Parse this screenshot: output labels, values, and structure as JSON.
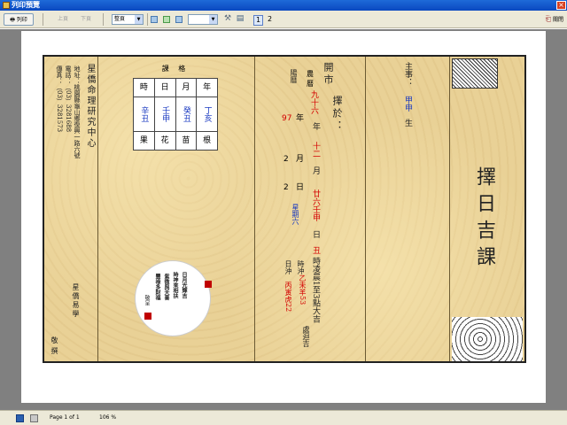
{
  "window": {
    "title": "列印預覽"
  },
  "toolbar": {
    "print_label": "列印",
    "prev_label": "上頁",
    "next_label": "下頁",
    "zoom_select": "整頁",
    "page_buttons": [
      "1",
      "2"
    ],
    "close_label": "關閉"
  },
  "status": {
    "page": "Page 1 of 1",
    "zoom": "106 %"
  },
  "doc": {
    "institute": "星僑命理研究中心",
    "address": "地址：桃園縣龜山鄉復興一路六號",
    "phone": "電話：（03）3281688",
    "fax": "傳真：（03）3281573",
    "footer_name": "星僑易學",
    "footer_note": "敬撰",
    "table_title": "課 格",
    "headers": [
      "時",
      "日",
      "月",
      "年"
    ],
    "pillars": [
      "辛丑",
      "壬申",
      "癸丑",
      "丁亥"
    ],
    "labels": [
      "果",
      "花",
      "苗",
      "根"
    ],
    "poem": [
      "日月光輝吉",
      "時神來相扶",
      "紫微與天喜",
      "豐祿多財福"
    ],
    "poem_sign": "敬呈",
    "open_title": "開市",
    "choose_on": "擇於：",
    "lunar_label": "農曆",
    "lunar_year": "九十六",
    "lunar_month": "十二",
    "solar_label": "陽曆",
    "solar_year": "97",
    "solar_month": "2",
    "solar_day": "2",
    "weekday": "星期六",
    "lunar_day": "廿六壬申",
    "hour": "丑",
    "hour_text": "時凌晨1至3點大吉",
    "sha_label": "日沖",
    "sha_left": "丙寅虎22",
    "sha_time_label": "時沖",
    "sha_right": "乙未羊53",
    "avoid": "處迴吉",
    "owner_label": "主事：",
    "owner_name": "甲申",
    "owner_suffix": "生",
    "main_title": "擇日吉課",
    "colors": {
      "accent": "#d40000",
      "blue": "#1838c0",
      "green": "#0a8a0a",
      "paper": "#e9d196"
    }
  }
}
